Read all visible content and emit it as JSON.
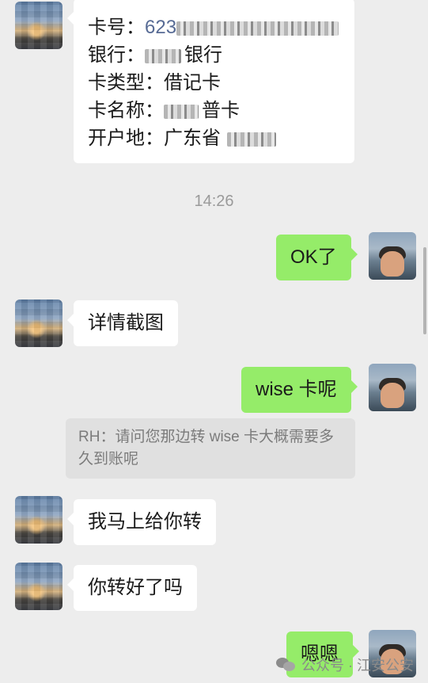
{
  "card": {
    "card_no_label": "卡号：",
    "card_no_value": "623",
    "bank_label": "银行：",
    "bank_value": "银行",
    "type_label": "卡类型：",
    "type_value": "借记卡",
    "name_label": "卡名称：",
    "name_value": "普卡",
    "location_label": "开户地：",
    "location_value": "广东省"
  },
  "timestamp": "14:26",
  "messages": {
    "ok": "OK了",
    "details": "详情截图",
    "wise": "wise 卡呢",
    "quote": "RH：请问您那边转 wise 卡大概需要多久到账呢",
    "transfer_now": "我马上给你转",
    "transferred": "你转好了吗",
    "enen": "嗯嗯"
  },
  "watermark": {
    "text": "公众号 · 江安公安"
  },
  "colors": {
    "background": "#ededed",
    "sent_bubble": "#95ec69",
    "received_bubble": "#ffffff",
    "link": "#576b95"
  }
}
